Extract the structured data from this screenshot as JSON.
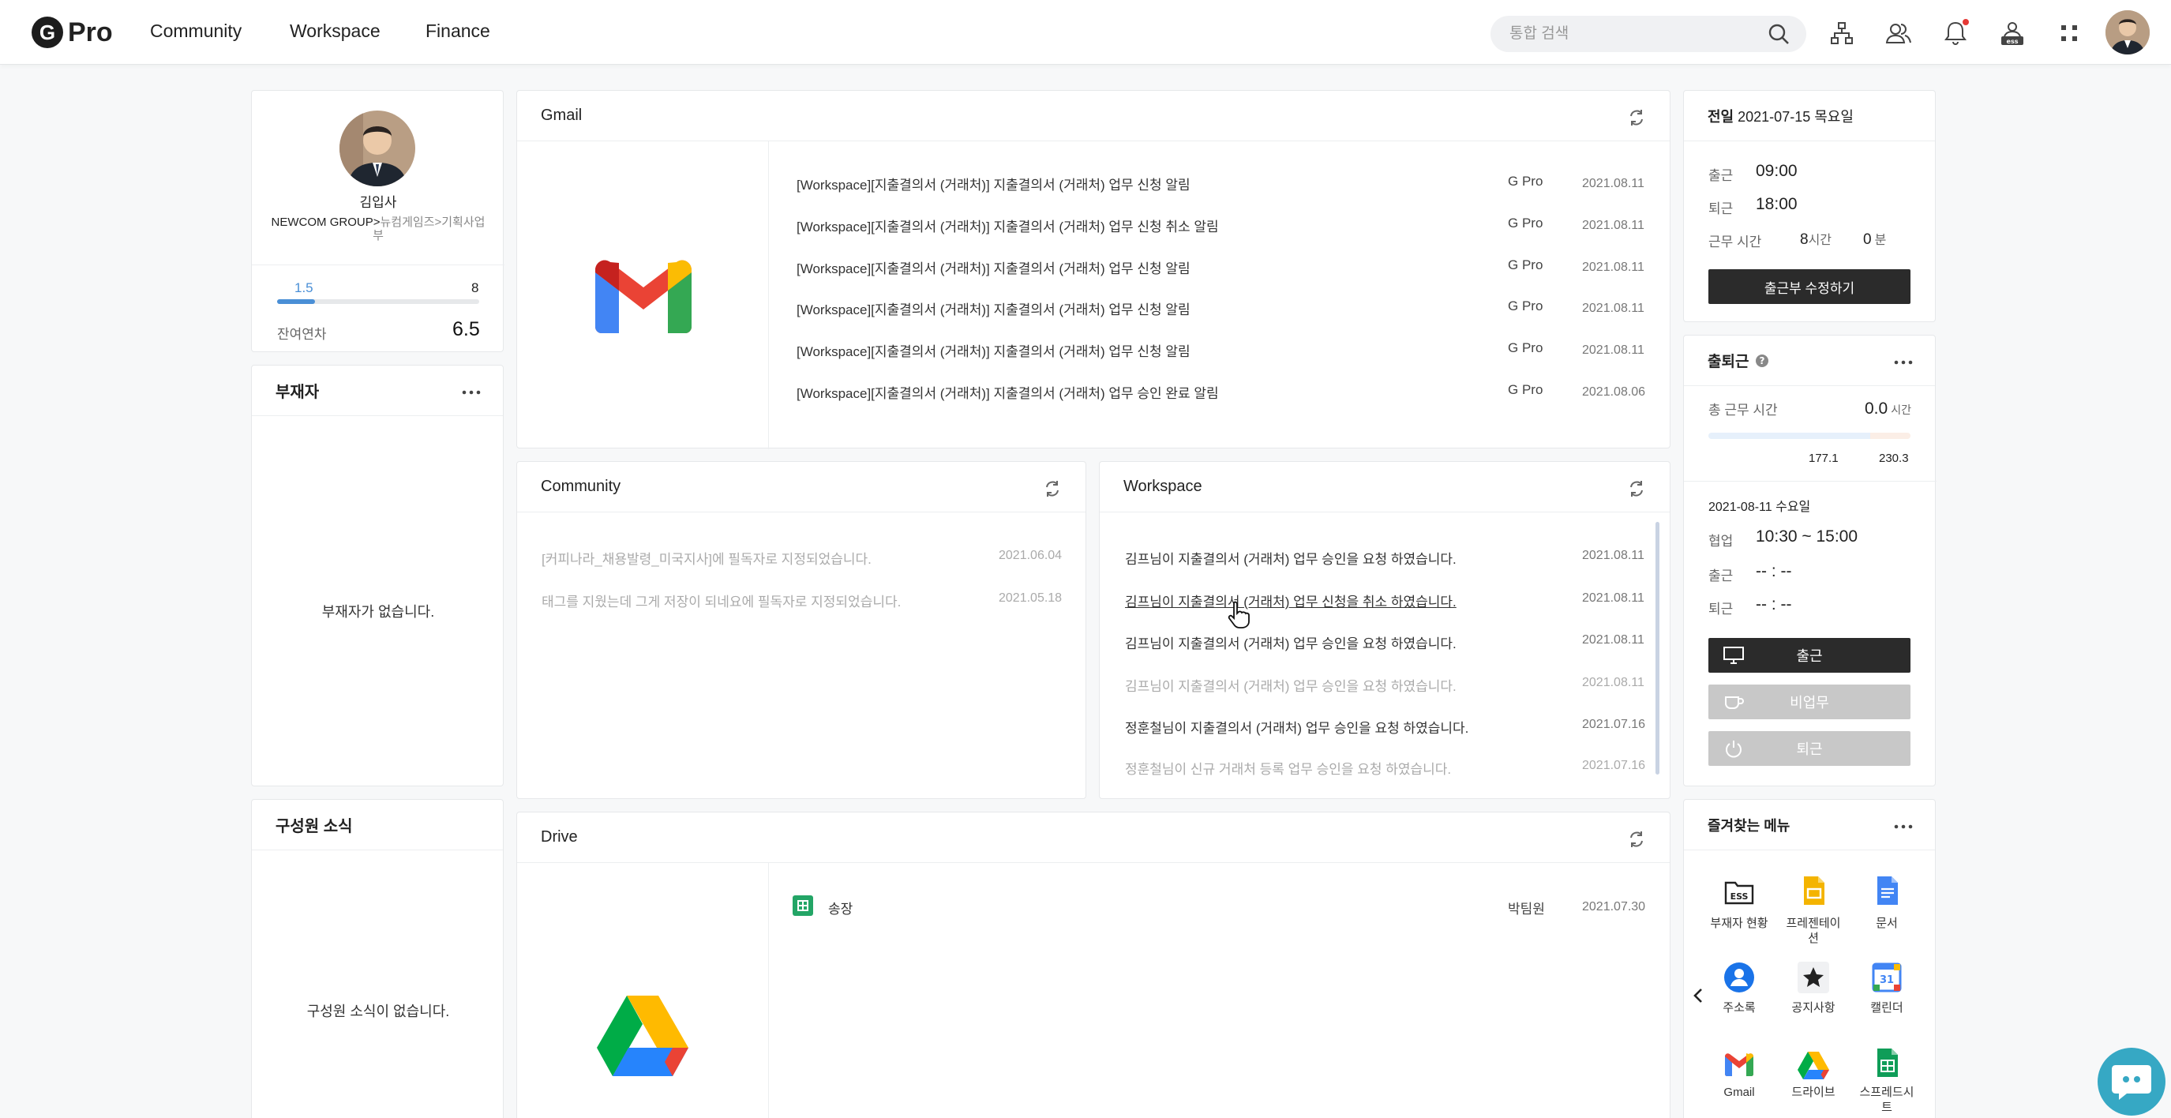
{
  "header": {
    "brand": "Pro",
    "brand_letter": "G",
    "nav": [
      "Community",
      "Workspace",
      "Finance"
    ],
    "search_placeholder": "통합 검색",
    "icons": [
      "org-chart-icon",
      "people-icon",
      "bell-icon",
      "ess-icon",
      "apps-grid-icon",
      "avatar"
    ]
  },
  "profile": {
    "name": "김입사",
    "org_prefix": "NEWCOM GROUP>",
    "org_rest": "뉴컴게임즈>기획사업",
    "org_line2": "부",
    "leave_used": "1.5",
    "leave_total": "8",
    "leave_used_fraction": 0.1875,
    "remaining_label": "잔여연차",
    "remaining_value": "6.5"
  },
  "absentee": {
    "title": "부재자",
    "empty": "부재자가 없습니다."
  },
  "members": {
    "title": "구성원 소식",
    "empty": "구성원 소식이 없습니다."
  },
  "gmail": {
    "title": "Gmail",
    "rows": [
      {
        "subject": "[Workspace][지출결의서 (거래처)] 지출결의서 (거래처) 업무 신청 알림",
        "sender": "G Pro",
        "date": "2021.08.11"
      },
      {
        "subject": "[Workspace][지출결의서 (거래처)] 지출결의서 (거래처) 업무 신청 취소 알림",
        "sender": "G Pro",
        "date": "2021.08.11"
      },
      {
        "subject": "[Workspace][지출결의서 (거래처)] 지출결의서 (거래처) 업무 신청 알림",
        "sender": "G Pro",
        "date": "2021.08.11"
      },
      {
        "subject": "[Workspace][지출결의서 (거래처)] 지출결의서 (거래처) 업무 신청 알림",
        "sender": "G Pro",
        "date": "2021.08.11"
      },
      {
        "subject": "[Workspace][지출결의서 (거래처)] 지출결의서 (거래처) 업무 신청 알림",
        "sender": "G Pro",
        "date": "2021.08.11"
      },
      {
        "subject": "[Workspace][지출결의서 (거래처)] 지출결의서 (거래처) 업무 승인 완료 알림",
        "sender": "G Pro",
        "date": "2021.08.06"
      }
    ]
  },
  "community": {
    "title": "Community",
    "rows": [
      {
        "text": "[커피나라_채용발령_미국지사]에 필독자로 지정되었습니다.",
        "date": "2021.06.04"
      },
      {
        "text": "태그를 지웠는데 그게 저장이 되네요에 필독자로 지정되었습니다.",
        "date": "2021.05.18"
      }
    ]
  },
  "workspace": {
    "title": "Workspace",
    "rows": [
      {
        "who": "김프",
        "text": "님이 지출결의서 (거래처) 업무 승인을 요청 하였습니다.",
        "date": "2021.08.11",
        "read": false
      },
      {
        "who": "김프",
        "text": "님이 지출결의서 (거래처) 업무 신청을 취소 하였습니다.",
        "date": "2021.08.11",
        "read": false
      },
      {
        "who": "김프",
        "text": "님이 지출결의서 (거래처) 업무 승인을 요청 하였습니다.",
        "date": "2021.08.11",
        "read": false
      },
      {
        "who": "김프",
        "text": "님이 지출결의서 (거래처) 업무 승인을 요청 하였습니다.",
        "date": "2021.08.11",
        "read": true
      },
      {
        "who": "정훈철",
        "text": "님이 지출결의서 (거래처) 업무 승인을 요청 하였습니다.",
        "date": "2021.07.16",
        "read": false
      },
      {
        "who": "정훈철",
        "text": "님이 신규 거래처 등록 업무 승인을 요청 하였습니다.",
        "date": "2021.07.16",
        "read": true
      }
    ]
  },
  "drive": {
    "title": "Drive",
    "rows": [
      {
        "name": "송장",
        "owner": "박팀원",
        "date": "2021.07.30"
      }
    ]
  },
  "prevday": {
    "title_prefix": "전일",
    "title_date": "2021-07-15 목요일",
    "in_label": "출근",
    "in_value": "09:00",
    "out_label": "퇴근",
    "out_value": "18:00",
    "hours_label": "근무 시간",
    "hours": "8",
    "hours_unit": "시간",
    "mins": "0",
    "mins_unit": "분",
    "edit_button": "출근부 수정하기"
  },
  "attendance": {
    "title": "출퇴근",
    "total_label": "총 근무 시간",
    "total_value": "0.0",
    "total_unit": "시간",
    "mark1": "177.1",
    "mark2": "230.3",
    "date": "2021-08-11 수요일",
    "collab_label": "협업",
    "collab_value": "10:30 ~ 15:00",
    "in_label": "출근",
    "in_value": "-- : --",
    "out_label": "퇴근",
    "out_value": "-- : --",
    "btn_in": "출근",
    "btn_offwork": "비업무",
    "btn_out": "퇴근"
  },
  "favorites": {
    "title": "즐겨찾는 메뉴",
    "items": [
      {
        "label": "부재자 현황",
        "icon": "ess-icon"
      },
      {
        "label": "프레젠테이",
        "label2": "션",
        "icon": "slides-icon"
      },
      {
        "label": "문서",
        "icon": "docs-icon"
      },
      {
        "label": "주소록",
        "icon": "contacts-icon"
      },
      {
        "label": "공지사항",
        "icon": "star-icon"
      },
      {
        "label": "캘린더",
        "icon": "calendar-icon",
        "badge": "31"
      },
      {
        "label": "Gmail",
        "icon": "gmail-icon"
      },
      {
        "label": "드라이브",
        "icon": "drive-icon"
      },
      {
        "label": "스프레드시",
        "label2": "트",
        "icon": "sheets-icon"
      }
    ]
  },
  "colors": {
    "accent": "#4a8fd6",
    "dark_button": "#2b2b2b",
    "disabled_button": "#c8c8c8",
    "chat": "#36a8c4"
  }
}
